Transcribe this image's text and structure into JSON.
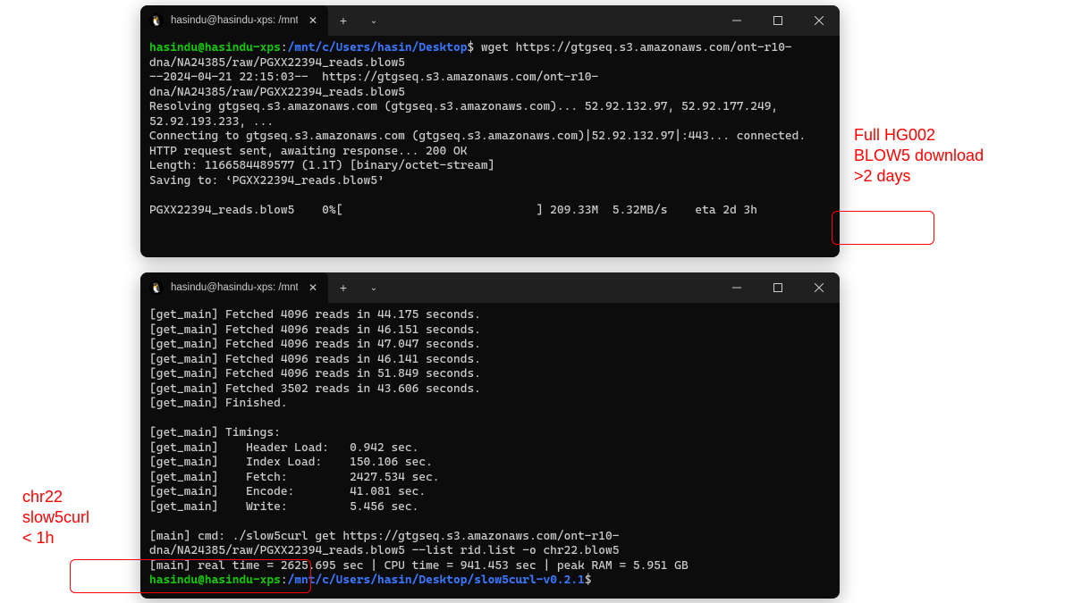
{
  "terminal1": {
    "tab_title": "hasindu@hasindu-xps: /mnt/c",
    "prompt_user": "hasindu@hasindu-xps",
    "prompt_sep": ":",
    "prompt_path": "/mnt/c/Users/hasin/Desktop",
    "prompt_dollar": "$",
    "command": "wget https://gtgseq.s3.amazonaws.com/ont-r10-dna/NA24385/raw/PGXX22394_reads.blow5",
    "lines": [
      "--2024-04-21 22:15:03--  https://gtgseq.s3.amazonaws.com/ont-r10-dna/NA24385/raw/PGXX22394_reads.blow5",
      "Resolving gtgseq.s3.amazonaws.com (gtgseq.s3.amazonaws.com)... 52.92.132.97, 52.92.177.249, 52.92.193.233, ...",
      "Connecting to gtgseq.s3.amazonaws.com (gtgseq.s3.amazonaws.com)|52.92.132.97|:443... connected.",
      "HTTP request sent, awaiting response... 200 OK",
      "Length: 1166584489577 (1.1T) [binary/octet-stream]",
      "Saving to: ‘PGXX22394_reads.blow5’",
      "",
      "PGXX22394_reads.blow5    0%[                            ] 209.33M  5.32MB/s    eta 2d 3h  "
    ]
  },
  "terminal2": {
    "tab_title": "hasindu@hasindu-xps: /mnt/c",
    "lines": [
      "[get_main] Fetched 4096 reads in 44.175 seconds.",
      "[get_main] Fetched 4096 reads in 46.151 seconds.",
      "[get_main] Fetched 4096 reads in 47.047 seconds.",
      "[get_main] Fetched 4096 reads in 46.141 seconds.",
      "[get_main] Fetched 4096 reads in 51.849 seconds.",
      "[get_main] Fetched 3502 reads in 43.606 seconds.",
      "[get_main] Finished.",
      "",
      "[get_main] Timings:",
      "[get_main]    Header Load:   0.942 sec.",
      "[get_main]    Index Load:    150.106 sec.",
      "[get_main]    Fetch:         2427.534 sec.",
      "[get_main]    Encode:        41.081 sec.",
      "[get_main]    Write:         5.456 sec.",
      "",
      "[main] cmd: ./slow5curl get https://gtgseq.s3.amazonaws.com/ont-r10-dna/NA24385/raw/PGXX22394_reads.blow5 --list rid.list -o chr22.blow5",
      "[main] real time = 2625.695 sec | CPU time = 941.453 sec | peak RAM = 5.951 GB"
    ],
    "prompt_user": "hasindu@hasindu-xps",
    "prompt_sep": ":",
    "prompt_path": "/mnt/c/Users/hasin/Desktop/slow5curl-v0.2.1",
    "prompt_dollar": "$"
  },
  "annotation1": "Full HG002\nBLOW5 download\n>2 days",
  "annotation2": "chr22\nslow5curl\n< 1h",
  "icons": {
    "tux": "🐧",
    "close": "✕",
    "plus": "+",
    "chevron": "⌄"
  }
}
